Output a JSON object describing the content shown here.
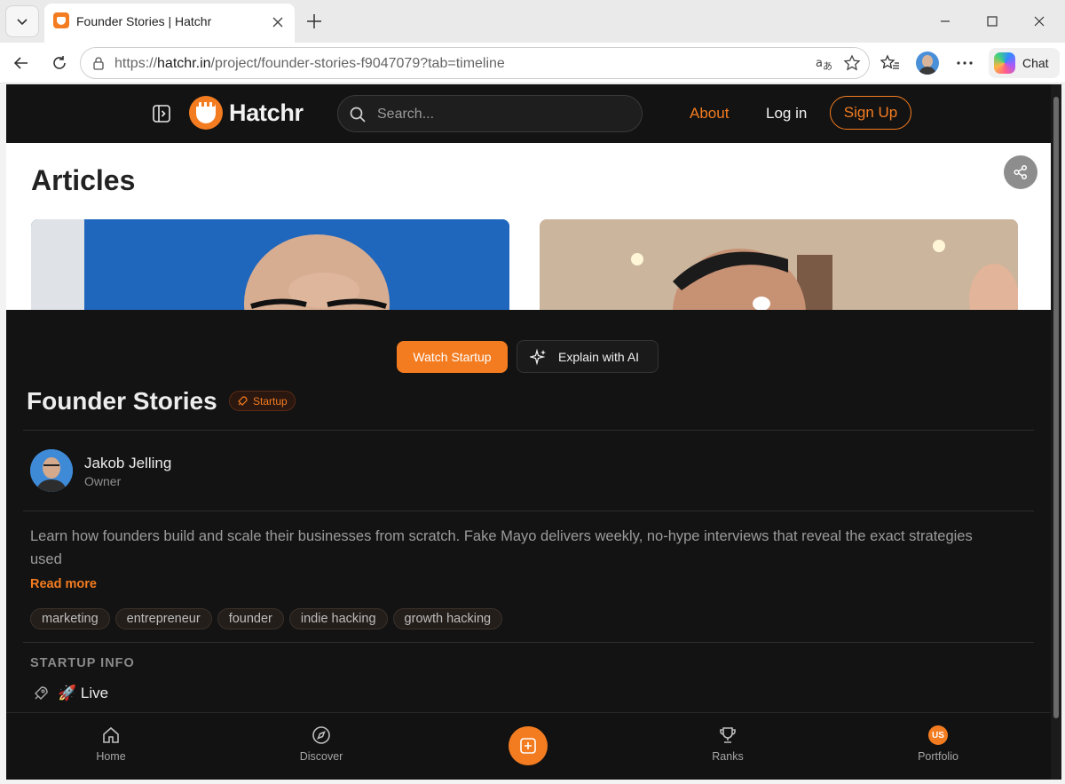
{
  "browser": {
    "tab_title": "Founder Stories | Hatchr",
    "url_prefix": "https://",
    "url_host": "hatchr.in",
    "url_path": "/project/founder-stories-f9047079?tab=timeline",
    "chat_label": "Chat"
  },
  "header": {
    "logo": "Hatchr",
    "search_placeholder": "Search...",
    "about": "About",
    "login": "Log in",
    "signup": "Sign Up"
  },
  "hero": {
    "heading": "Articles"
  },
  "actions": {
    "watch": "Watch Startup",
    "explain": "Explain with AI"
  },
  "project": {
    "title": "Founder Stories",
    "badge": "Startup",
    "owner_name": "Jakob Jelling",
    "owner_role": "Owner",
    "description": "Learn how founders build and scale their businesses from scratch. Fake Mayo delivers weekly, no-hype interviews that reveal the exact strategies used",
    "read_more": "Read more",
    "tags": [
      "marketing",
      "entrepreneur",
      "founder",
      "indie hacking",
      "growth hacking"
    ],
    "info_heading": "STARTUP INFO",
    "status": "🚀 Live"
  },
  "bottom_nav": {
    "home": "Home",
    "discover": "Discover",
    "ranks": "Ranks",
    "portfolio": "Portfolio",
    "portfolio_initials": "US"
  },
  "colors": {
    "accent": "#f47c20",
    "background": "#131313"
  }
}
